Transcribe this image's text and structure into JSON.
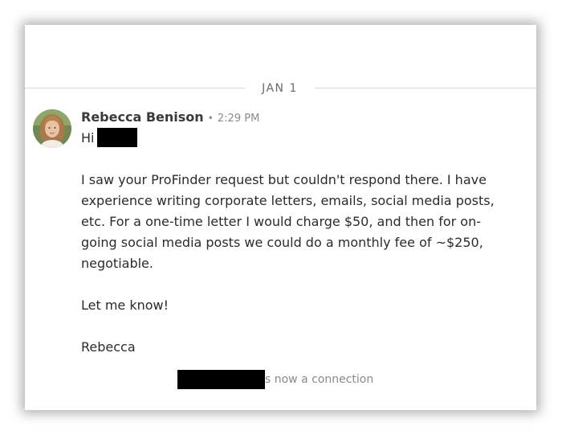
{
  "conversation": {
    "date_divider": "JAN 1",
    "message": {
      "sender": "Rebecca Benison",
      "separator": "•",
      "time": "2:29 PM",
      "greeting": "Hi",
      "paragraphs": [
        "I saw your ProFinder request but couldn't respond there. I have experience writing corporate letters, emails, social media posts, etc. For a one-time letter I would charge $50, and then for on-going social media posts we could do a monthly fee of ~$250, negotiable.",
        "Let me know!",
        "Rebecca"
      ]
    },
    "connection_notice": "s now a connection"
  },
  "colors": {
    "divider": "#d6d6d6",
    "muted_text": "#8a8a8a",
    "body_text": "#2b2b2b",
    "redaction": "#000000"
  },
  "icons": {
    "avatar": "profile-photo"
  }
}
